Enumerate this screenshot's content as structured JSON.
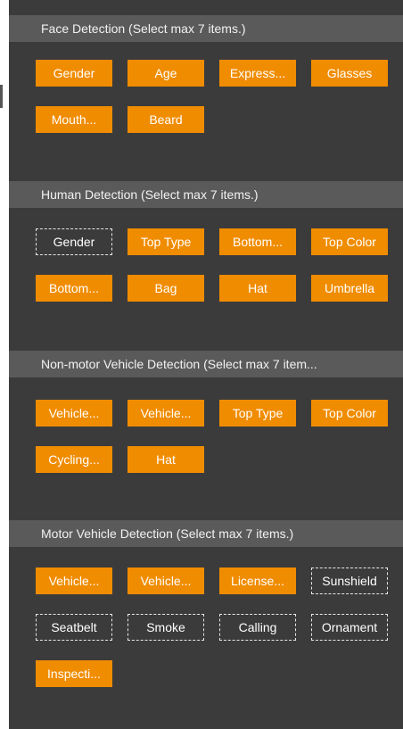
{
  "sections": [
    {
      "title": "Face Detection (Select max 7 items.)",
      "items": [
        {
          "label": "Gender",
          "on": true
        },
        {
          "label": "Age",
          "on": true
        },
        {
          "label": "Express...",
          "on": true
        },
        {
          "label": "Glasses",
          "on": true
        },
        {
          "label": "Mouth...",
          "on": true
        },
        {
          "label": "Beard",
          "on": true
        }
      ]
    },
    {
      "title": "Human Detection (Select max 7 items.)",
      "items": [
        {
          "label": "Gender",
          "on": false
        },
        {
          "label": "Top Type",
          "on": true
        },
        {
          "label": "Bottom...",
          "on": true
        },
        {
          "label": "Top Color",
          "on": true
        },
        {
          "label": "Bottom...",
          "on": true
        },
        {
          "label": "Bag",
          "on": true
        },
        {
          "label": "Hat",
          "on": true
        },
        {
          "label": "Umbrella",
          "on": true
        }
      ]
    },
    {
      "title": "Non-motor Vehicle Detection (Select max 7 item...",
      "items": [
        {
          "label": "Vehicle...",
          "on": true
        },
        {
          "label": "Vehicle...",
          "on": true
        },
        {
          "label": "Top Type",
          "on": true
        },
        {
          "label": "Top Color",
          "on": true
        },
        {
          "label": "Cycling...",
          "on": true
        },
        {
          "label": "Hat",
          "on": true
        }
      ]
    },
    {
      "title": "Motor Vehicle Detection (Select max 7 items.)",
      "items": [
        {
          "label": "Vehicle...",
          "on": true
        },
        {
          "label": "Vehicle...",
          "on": true
        },
        {
          "label": "License...",
          "on": true
        },
        {
          "label": "Sunshield",
          "on": false
        },
        {
          "label": "Seatbelt",
          "on": false
        },
        {
          "label": "Smoke",
          "on": false
        },
        {
          "label": "Calling",
          "on": false
        },
        {
          "label": "Ornament",
          "on": false
        },
        {
          "label": "Inspecti...",
          "on": true
        }
      ]
    }
  ],
  "colors": {
    "selected": "#f08c00",
    "panel": "#3b3b3b",
    "header": "#5a5a5a"
  }
}
